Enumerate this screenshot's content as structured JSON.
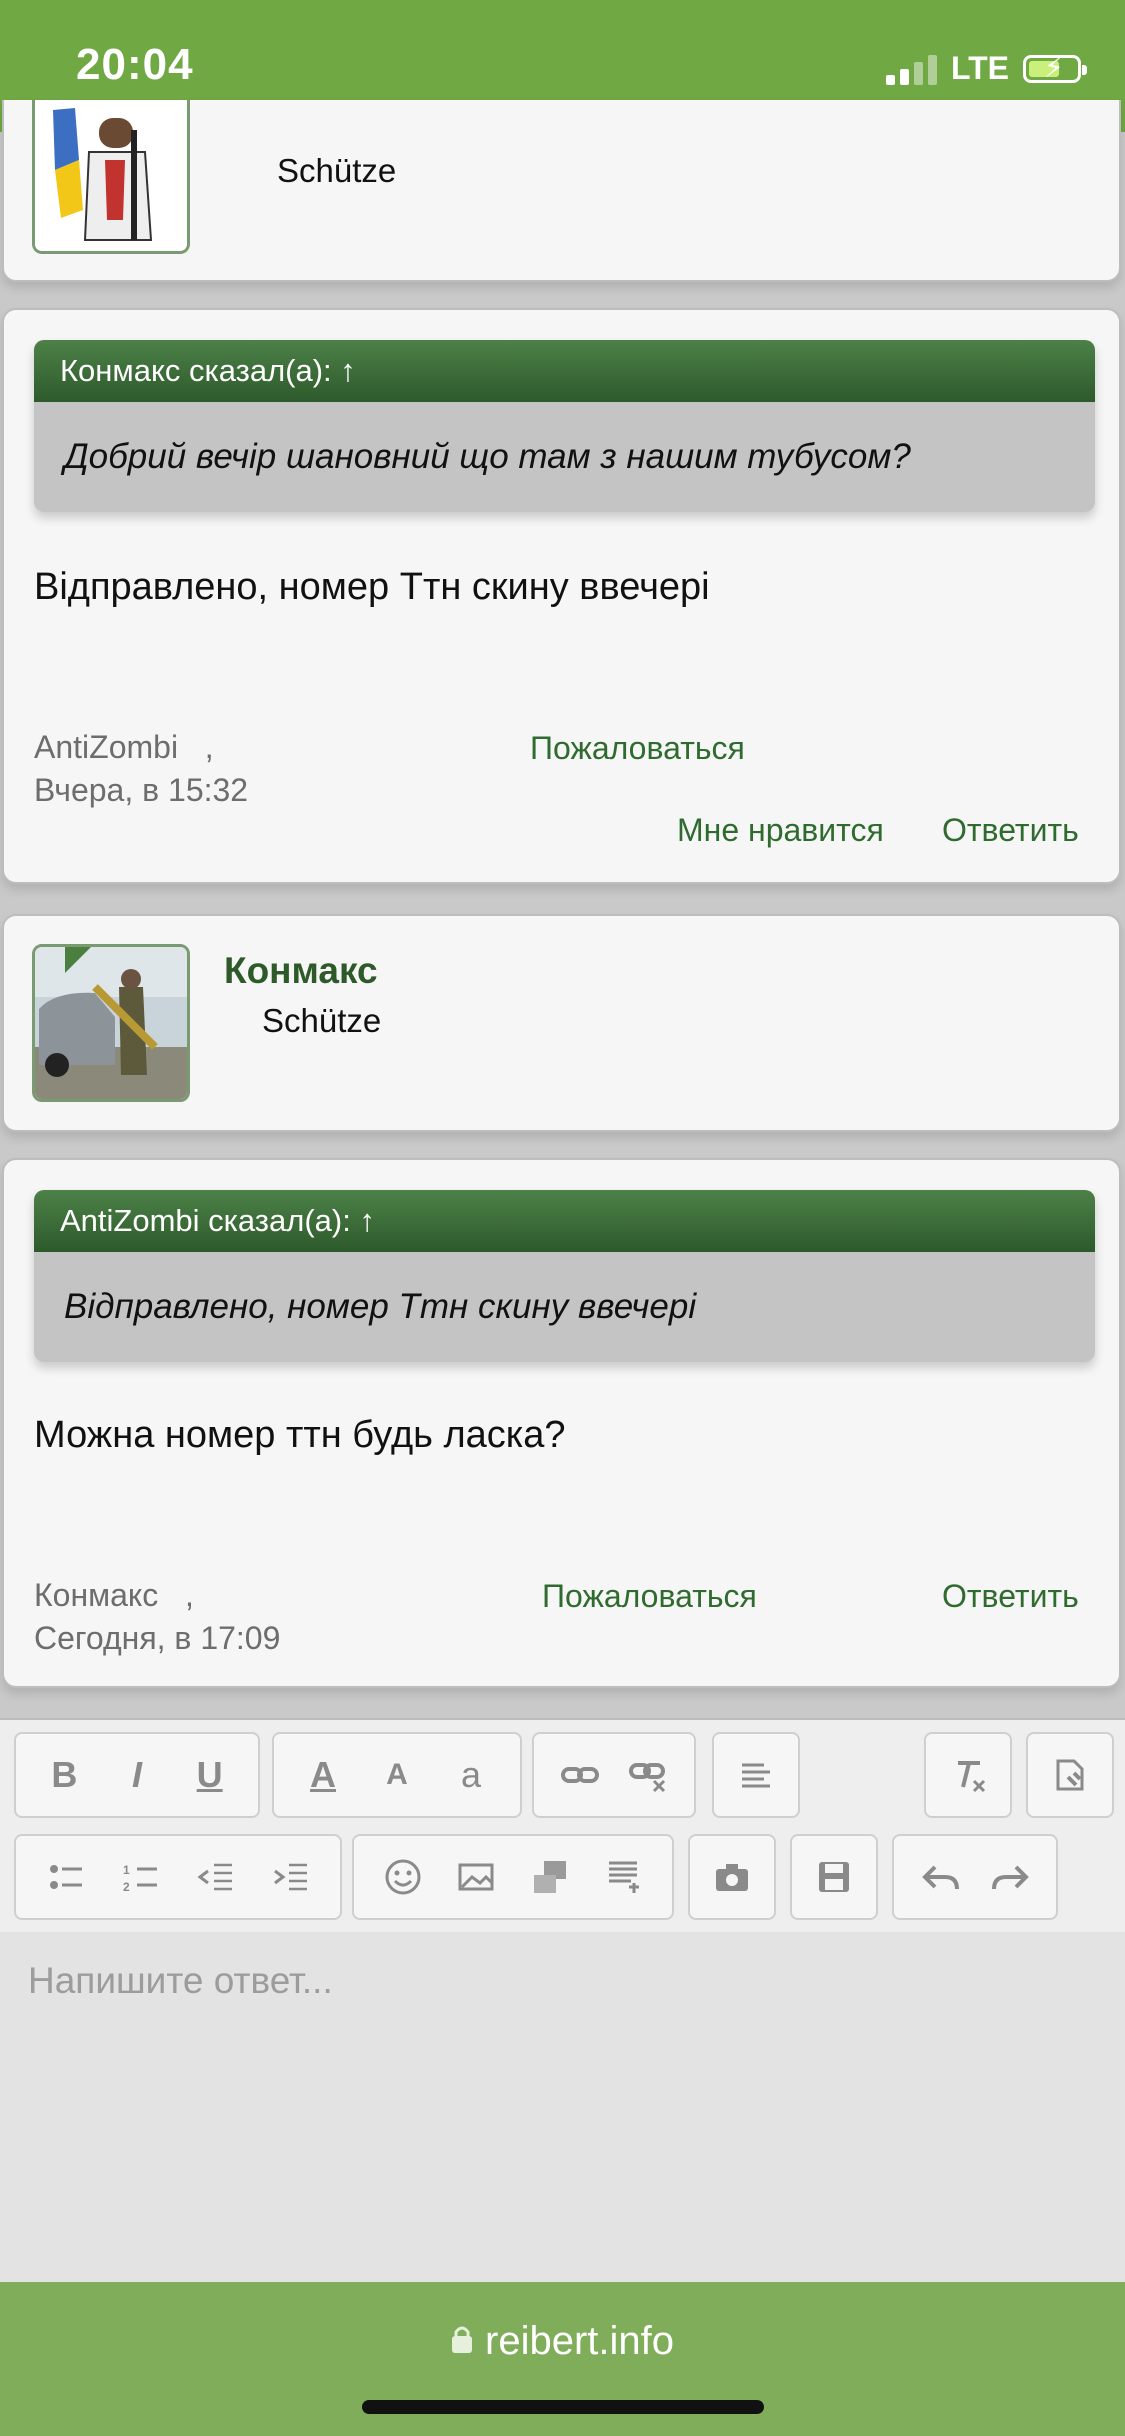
{
  "status": {
    "time": "20:04",
    "network": "LTE"
  },
  "posts": [
    {
      "rank": "Schütze"
    },
    {
      "quote_header": "Конмакс сказал(а): ↑",
      "quote_text": "Добрий вечір шановний що там з нашим тубусом?",
      "message": "Відправлено, номер Ттн скину ввечері",
      "author": "AntiZombi",
      "separator": ",",
      "date": "Вчера, в 15:32",
      "report": "Пожаловаться",
      "like": "Мне нравится",
      "reply": "Ответить"
    },
    {
      "username": "Конмакс",
      "rank": "Schütze"
    },
    {
      "quote_header": "AntiZombi сказал(а): ↑",
      "quote_text": "Відправлено, номер Ттн скину ввечері",
      "message": "Можна номер ттн будь ласка?",
      "author": "Конмакс",
      "separator": ",",
      "date": "Сегодня, в 17:09",
      "report": "Пожаловаться",
      "reply": "Ответить"
    }
  ],
  "editor": {
    "placeholder": "Напишите ответ...",
    "toolbar": {
      "bold": "B",
      "italic": "I",
      "underline": "U",
      "font_color": "A",
      "font_size": "A",
      "font_family": "a",
      "icons": [
        "bold-icon",
        "italic-icon",
        "underline-icon",
        "font-color-icon",
        "font-size-icon",
        "font-family-icon",
        "link-icon",
        "unlink-icon",
        "align-icon",
        "remove-format-icon",
        "bbcode-toggle-icon",
        "bullet-list-icon",
        "numbered-list-icon",
        "outdent-icon",
        "indent-icon",
        "smilie-icon",
        "image-icon",
        "media-icon",
        "insert-template-icon",
        "camera-icon",
        "save-draft-icon",
        "undo-icon",
        "redo-icon"
      ]
    }
  },
  "browser": {
    "url": "reibert.info"
  },
  "colors": {
    "status_bar": "#70a844",
    "bottom_bar": "#80ad59",
    "quote_header": "#3d6e3a",
    "link": "#2f6b2f",
    "username": "#2e5a2a"
  }
}
